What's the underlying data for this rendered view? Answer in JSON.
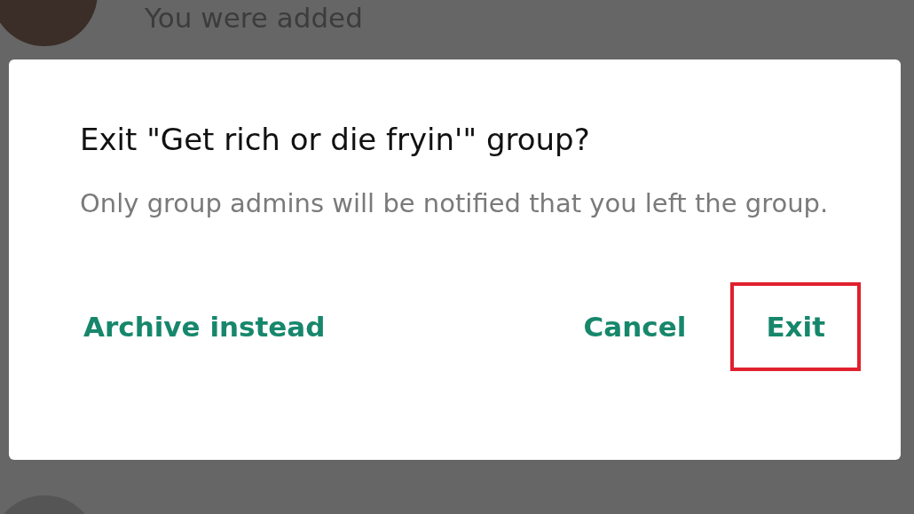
{
  "background_chat": {
    "subtitle": "You were added"
  },
  "dialog": {
    "title": "Exit \"Get rich or die fryin'\" group?",
    "message": "Only group admins will be notified that you left the group.",
    "buttons": [
      {
        "label": "Archive instead",
        "highlighted": false
      },
      {
        "label": "Cancel",
        "highlighted": false
      },
      {
        "label": "Exit",
        "highlighted": true
      }
    ]
  }
}
